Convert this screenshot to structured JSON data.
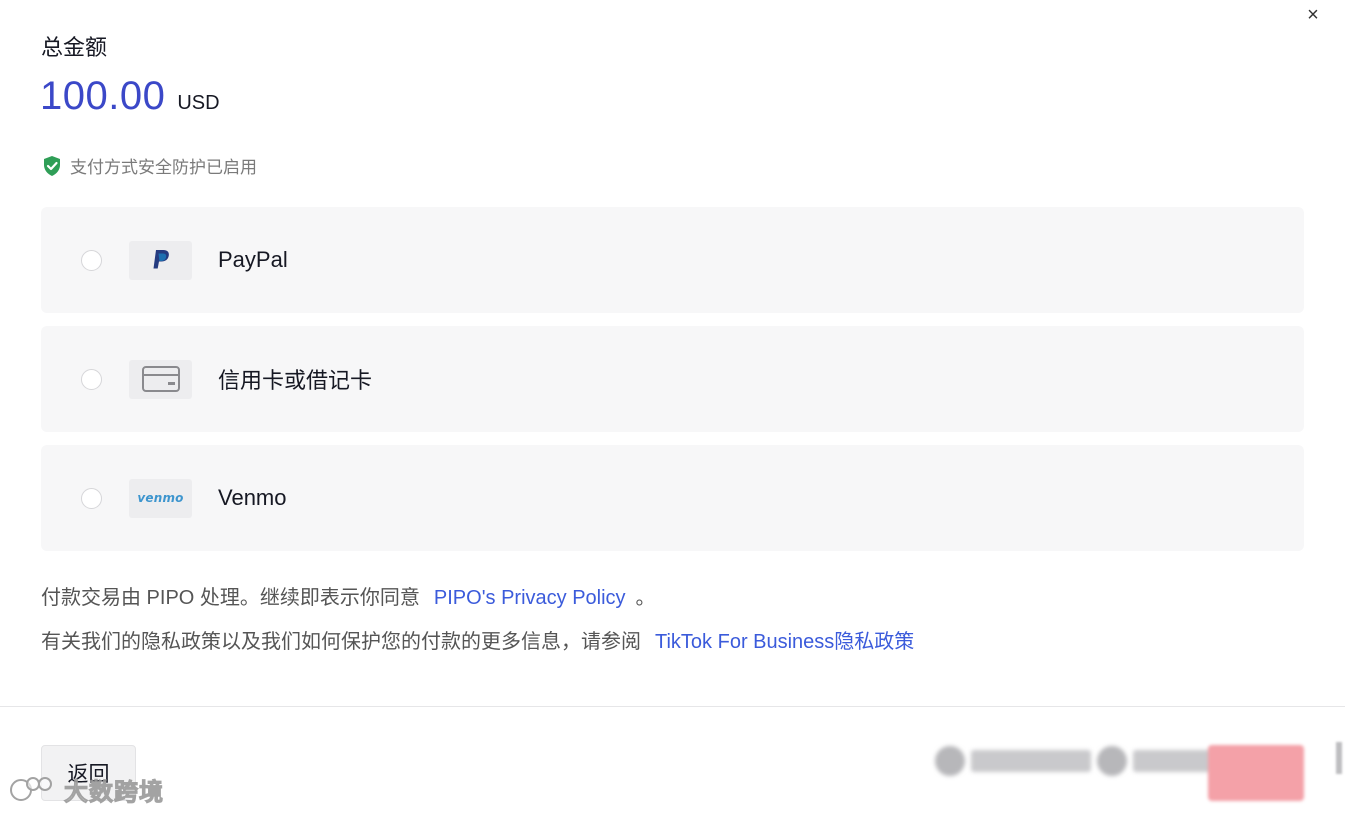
{
  "dialog": {
    "close_glyph": "×",
    "total_label": "总金额",
    "amount": "100.00",
    "currency": "USD",
    "security_note": "支付方式安全防护已启用"
  },
  "payment_methods": [
    {
      "label": "PayPal",
      "logo_text": "P",
      "icon": "paypal-logo",
      "selected": false
    },
    {
      "label": "信用卡或借记卡",
      "icon": "credit-card-icon",
      "selected": false
    },
    {
      "label": "Venmo",
      "logo_text": "venmo",
      "icon": "venmo-logo",
      "selected": false
    }
  ],
  "legal": {
    "line1_text": "付款交易由 PIPO 处理。继续即表示你同意",
    "line1_link": "PIPO's Privacy Policy",
    "line1_end": "。",
    "line2_text": "有关我们的隐私政策以及我们如何保护您的付款的更多信息，请参阅",
    "line2_link": "TikTok For Business隐私政策"
  },
  "footer": {
    "back_label": "返回",
    "watermark_text": "大数跨境"
  },
  "colors": {
    "accent": "#3b48c8",
    "link": "#3b5bdb",
    "shield": "#2f9e57",
    "confirm": "#f4a1a8"
  }
}
